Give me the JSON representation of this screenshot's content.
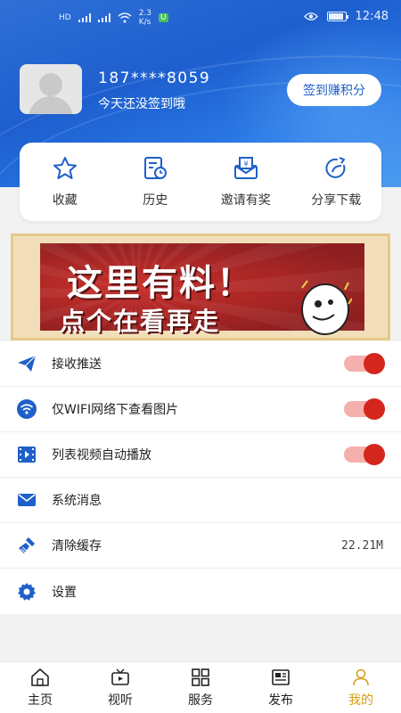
{
  "status_bar": {
    "net_type_1": "HD",
    "net_type_2": "HD",
    "speed": "2.3",
    "speed_unit": "K/s",
    "time": "12:48",
    "battery": "80"
  },
  "profile": {
    "phone": "187****8059",
    "signin_note": "今天还没签到哦",
    "signin_button": "签到赚积分"
  },
  "quick_actions": [
    {
      "label": "收藏",
      "icon": "star-icon"
    },
    {
      "label": "历史",
      "icon": "history-icon"
    },
    {
      "label": "邀请有奖",
      "icon": "invite-gift-icon"
    },
    {
      "label": "分享下载",
      "icon": "share-icon"
    }
  ],
  "banner": {
    "line1": "这里有料！",
    "line2": "点个在看再走"
  },
  "settings": [
    {
      "label": "接收推送",
      "icon": "paper-plane-icon",
      "toggle": true
    },
    {
      "label": "仅WIFI网络下查看图片",
      "icon": "wifi-icon",
      "toggle": true
    },
    {
      "label": "列表视频自动播放",
      "icon": "video-icon",
      "toggle": true
    },
    {
      "label": "系统消息",
      "icon": "mail-icon"
    },
    {
      "label": "清除缓存",
      "icon": "broom-icon",
      "value": "22.21M"
    },
    {
      "label": "设置",
      "icon": "gear-icon"
    }
  ],
  "bottom_nav": [
    {
      "label": "主页",
      "icon": "home-icon"
    },
    {
      "label": "视听",
      "icon": "tv-icon"
    },
    {
      "label": "服务",
      "icon": "grid-icon"
    },
    {
      "label": "发布",
      "icon": "newspaper-icon"
    },
    {
      "label": "我的",
      "icon": "user-icon",
      "active": true
    }
  ],
  "colors": {
    "header_blue": "#1e5fcf",
    "toggle_on": "#d4261d",
    "active_nav": "#d4a017",
    "icon_blue": "#1e60c8"
  }
}
